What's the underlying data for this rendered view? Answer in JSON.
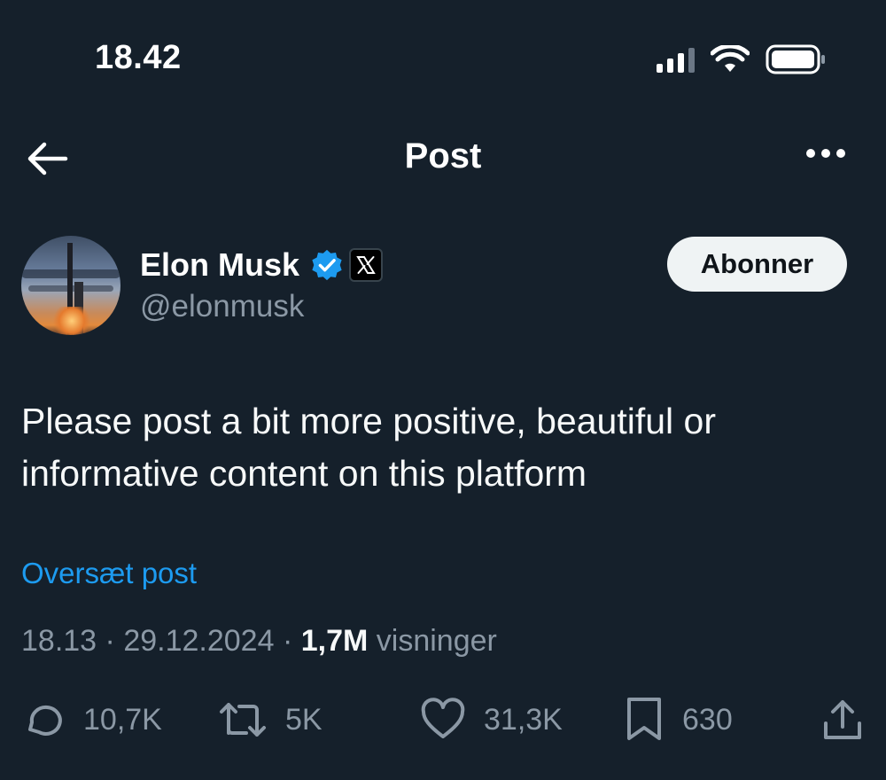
{
  "status_bar": {
    "time": "18.42"
  },
  "nav": {
    "title": "Post"
  },
  "author": {
    "name": "Elon Musk",
    "handle": "@elonmusk",
    "follow_label": "Abonner"
  },
  "post": {
    "text_line1": "Please post a bit more positive, beautiful or",
    "text_line2": "informative content on this platform",
    "translate_label": "Oversæt post",
    "time": "18.13",
    "date": "29.12.2024",
    "views_count": "1,7M",
    "views_label": "visninger"
  },
  "actions": {
    "replies": "10,7K",
    "reposts": "5K",
    "likes": "31,3K",
    "bookmarks": "630"
  },
  "icons": {
    "back": "arrow-left-icon",
    "more": "more-horizontal-icon",
    "verified": "verified-badge-icon",
    "affiliate": "x-logo-icon",
    "reply": "reply-icon",
    "repost": "repost-icon",
    "like": "heart-icon",
    "bookmark": "bookmark-icon",
    "share": "share-icon"
  },
  "colors": {
    "background": "#15202b",
    "accent": "#1d9bf0",
    "muted": "#8b98a5",
    "verified": "#1d9bf0"
  }
}
